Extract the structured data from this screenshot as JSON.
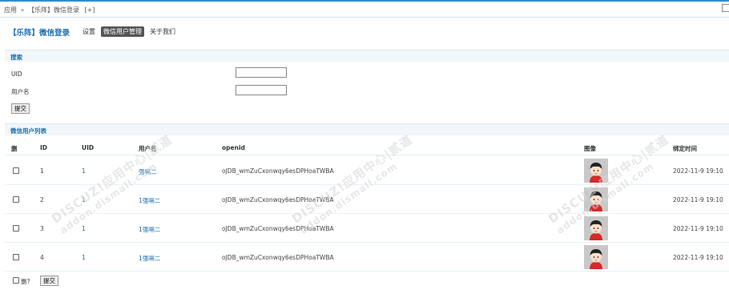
{
  "breadcrumb": {
    "root": "应用",
    "sep": "»",
    "current": "【乐阵】微信登录",
    "add": "[+]"
  },
  "plugin_title": "【乐阵】微信登录",
  "nav_tabs": [
    {
      "label": "设置",
      "active": false
    },
    {
      "label": "微信用户管理",
      "active": true
    },
    {
      "label": "关于我们",
      "active": false
    }
  ],
  "search": {
    "section_title": "搜索",
    "uid_label": "UID",
    "uid_value": "",
    "username_label": "用户名",
    "username_value": "",
    "submit_label": "提交"
  },
  "list": {
    "section_title": "微信用户列表",
    "columns": [
      "删",
      "ID",
      "UID",
      "用户名",
      "openid",
      "图像",
      "绑定时间"
    ],
    "rows": [
      {
        "id": "1",
        "uid": "1",
        "username": "强嗝二",
        "openid": "oJDB_wmZuCxonwqy6esDPHoaTWBA",
        "bind_time": "2022-11-9 19:10"
      },
      {
        "id": "2",
        "uid": "1",
        "username": "1强嗝二",
        "openid": "oJDB_wmZuCxonwqy6esDPHoaTWBA",
        "bind_time": "2022-11-9 19:10"
      },
      {
        "id": "3",
        "uid": "1",
        "username": "1强嗝二",
        "openid": "oJDB_wmZuCxonwqy6esDPHoaTWBA",
        "bind_time": "2022-11-9 19:10"
      },
      {
        "id": "4",
        "uid": "1",
        "username": "1强嗝二",
        "openid": "oJDB_wmZuCxonwqy6esDPHoaTWBA",
        "bind_time": "2022-11-9 19:10"
      }
    ]
  },
  "footer": {
    "delete_label": "删?",
    "submit_label": "提交"
  },
  "watermark": {
    "line1": "DISCUZ!应用中心|贰道",
    "line2": "addon.dismall.com"
  },
  "colors": {
    "accent": "#1e6fb0",
    "topbar": "#2f8fc8",
    "section_bg": "#f1f7fb"
  }
}
